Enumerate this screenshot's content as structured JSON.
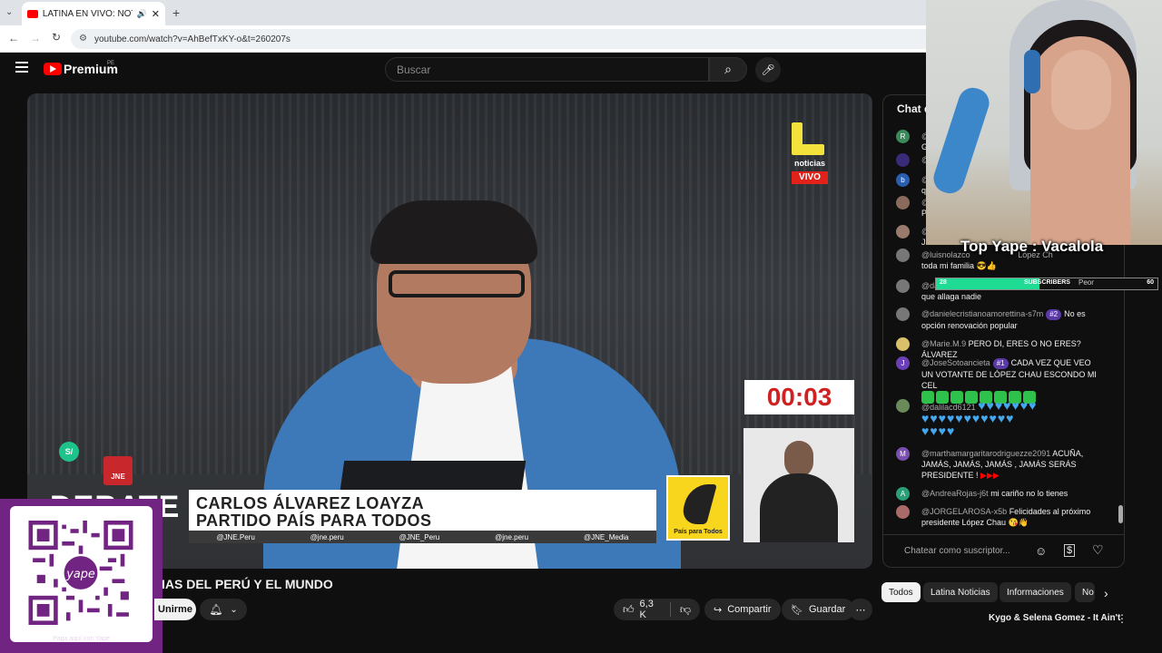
{
  "browser": {
    "tab_title": "LATINA EN VIVO: NOTICIAS",
    "url": "youtube.com/watch?v=AhBefTxKY-o&t=260207s"
  },
  "youtube": {
    "logo_text": "Premium",
    "region": "PE",
    "search_placeholder": "Buscar"
  },
  "video": {
    "channel_logo_text": "noticias",
    "live_badge": "VIVO",
    "timer": "00:03",
    "lower_third_name": "CARLOS ÁLVAREZ LOAYZA",
    "lower_third_party": "PARTIDO PAÍS PARA TODOS",
    "social_handles": [
      "@JNE.Peru",
      "@jne.peru",
      "@JNE_Peru",
      "@jne.peru",
      "@JNE_Media"
    ],
    "party_logo_text": "País para Todos",
    "debate_text": "DEBATE",
    "jne_label": "JNE",
    "yape_badge": "S/"
  },
  "qr": {
    "caption": "Paga aquí con Yape",
    "brand": "yape"
  },
  "below": {
    "title": "IAS DEL PERÚ Y EL MUNDO",
    "subscribe_label": "Unirme",
    "likes": "6,3 K",
    "share_label": "Compartir",
    "save_label": "Guardar"
  },
  "chat": {
    "header": "Chat de",
    "input_placeholder": "Chatear como suscriptor...",
    "messages": [
      {
        "avatar": "R",
        "color": "#3b8a5a",
        "author": "@",
        "text": "G"
      },
      {
        "avatar": "",
        "color": "#3a2a7a",
        "author": "@",
        "text": ""
      },
      {
        "avatar": "b",
        "color": "#2a5fb0",
        "author": "@",
        "text": "q"
      },
      {
        "avatar": "",
        "color": "#8a6a5a",
        "author": "@",
        "text": "P"
      },
      {
        "avatar": "",
        "color": "#9a7a6a",
        "author": "@",
        "text": "J"
      },
      {
        "avatar": "",
        "color": "#777",
        "author": "@luisnolazco",
        "text": "toda mi familia"
      },
      {
        "avatar": "",
        "color": "#777",
        "author": "@da",
        "text": "que allaga nadie"
      },
      {
        "avatar": "",
        "color": "#777",
        "author": "@danielecristianoamorettina-s7m",
        "badge": "#2",
        "text": "No es opción renovación popular"
      },
      {
        "avatar": "",
        "color": "#d9c06a",
        "author": "@Marie.M.9",
        "text": "PERO DI, ERES O NO ERES? ÁLVAREZ"
      },
      {
        "avatar": "J",
        "color": "#6b3fb6",
        "author": "@JoseSotoancieta",
        "badge": "#1",
        "text": "CADA VEZ QUE VEO UN VOTANTE DE LÓPEZ CHAU ESCONDO MI CEL"
      },
      {
        "avatar": "",
        "color": "#6a8a5a",
        "author": "@dalilacd6121",
        "text": ""
      },
      {
        "avatar": "M",
        "color": "#7a4fb0",
        "author": "@marthamargaritarodriguezze2091",
        "text": "ACUÑA, JAMÁS, JAMÁS, JAMÁS , JAMÁS SERÁS PRESIDENTE !"
      },
      {
        "avatar": "A",
        "color": "#2aa07a",
        "author": "@AndreaRojas-j6t",
        "text": "mi cariño no lo tienes"
      },
      {
        "avatar": "",
        "color": "#aa6a6a",
        "author": "@JORGELAROSA-x5b",
        "text": "Felicidades al próximo presidente López Chau"
      }
    ],
    "overlay_fragment": "López Ch",
    "overlay_word": "Peor"
  },
  "chips": [
    "Todos",
    "Latina Noticias",
    "Informaciones",
    "No"
  ],
  "overlay": {
    "top_yape": "Top Yape : Vacalola",
    "subs_left": "28",
    "subs_label": "SUBSCRIBERS",
    "subs_right": "60",
    "subs_fill": 0.467
  },
  "music": {
    "now_playing": "Kygo & Selena Gomez - It Ain't"
  },
  "colors": {
    "yt_red": "#ff0000",
    "yape_purple": "#722482",
    "accent_green": "#1fdc95"
  }
}
